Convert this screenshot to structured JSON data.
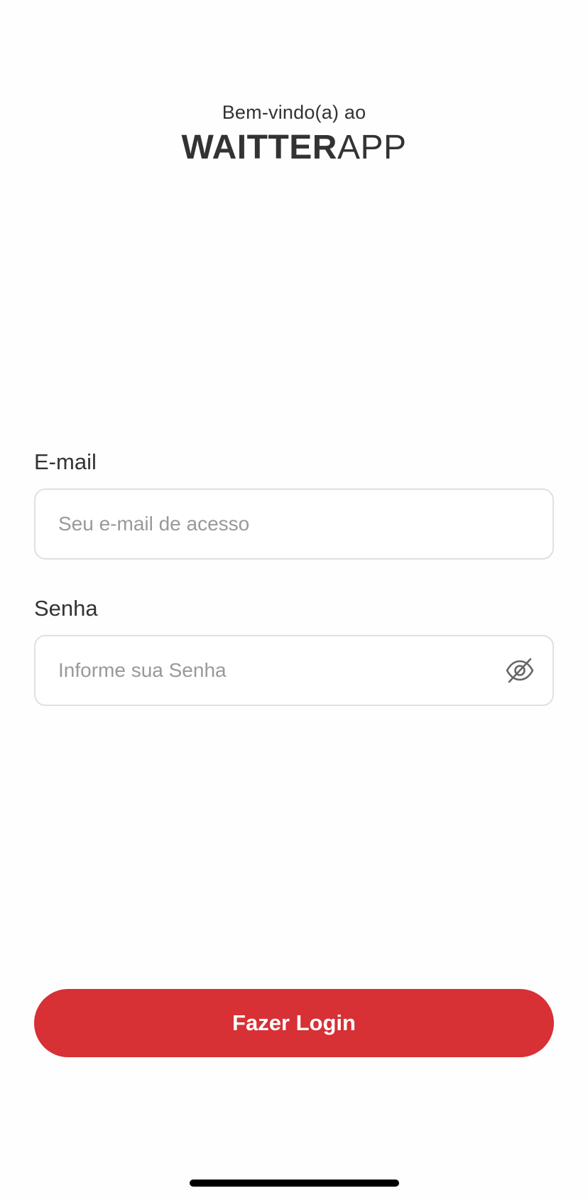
{
  "header": {
    "welcome": "Bem-vindo(a) ao",
    "brand_bold": "WAITTER",
    "brand_light": "APP"
  },
  "form": {
    "email": {
      "label": "E-mail",
      "placeholder": "Seu e-mail de acesso",
      "value": ""
    },
    "password": {
      "label": "Senha",
      "placeholder": "Informe sua Senha",
      "value": "",
      "toggle_icon": "eye-off-icon"
    }
  },
  "actions": {
    "login_label": "Fazer Login"
  },
  "colors": {
    "accent": "#d73035",
    "text": "#333333",
    "placeholder": "#999999",
    "border": "#e0e0e0"
  }
}
